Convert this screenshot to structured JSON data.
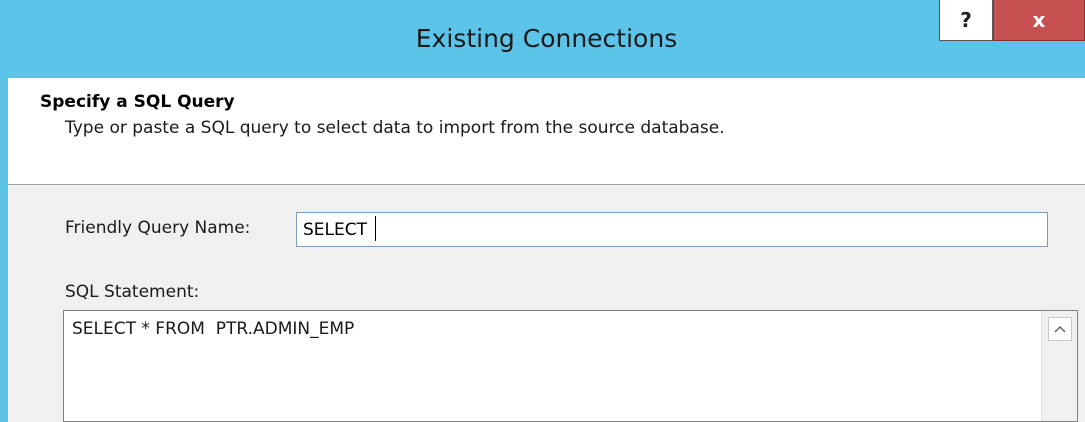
{
  "window": {
    "title": "Existing Connections",
    "help_label": "?",
    "close_label": "x"
  },
  "header": {
    "title": "Specify a SQL Query",
    "subtitle": "Type or paste a SQL query to select data to import from the source database."
  },
  "form": {
    "friendly_name_label": "Friendly Query Name:",
    "friendly_name_value": "SELECT",
    "sql_label": "SQL Statement:",
    "sql_value": "SELECT * FROM  PTR.ADMIN_EMP"
  },
  "icons": {
    "scroll_up": "chevron-up-icon"
  },
  "colors": {
    "titlebar": "#5bc4e8",
    "close_button": "#c75050"
  }
}
